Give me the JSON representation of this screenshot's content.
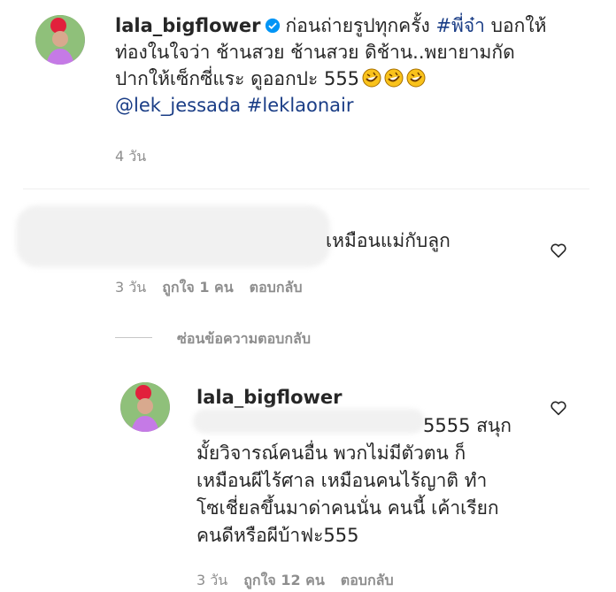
{
  "post": {
    "username": "lala_bigflower",
    "caption_line1": "ก่อนถ่ายรูปทุกครั้ง",
    "hashtag1": "#พี่จ๋า",
    "caption_line1_end": "บอกให้",
    "caption_line2": "ท่องในใจว่า ช้านสวย ช้านสวย ดิช้าน..พยายามกัด",
    "caption_line3": "ปากให้เซ็กซี่แระ ดูออกปะ 555",
    "mention": "@lek_jessada",
    "hashtag2": "#leklaonair",
    "time": "4 วัน"
  },
  "comment1": {
    "text": "เหมือนแม่กับลูก",
    "time": "3 วัน",
    "likes": "ถูกใจ 1 คน",
    "reply": "ตอบกลับ"
  },
  "hide_replies": "ซ่อนข้อความตอบกลับ",
  "reply1": {
    "username": "lala_bigflower",
    "line1_end": "5555 สนุก",
    "line2": "มั้ยวิจารณ์คนอื่น พวกไม่มีตัวตน ก็",
    "line3": "เหมือนผีไร้ศาล เหมือนคนไร้ญาติ ทำ",
    "line4": "โซเชี่ยลขึ้นมาด่าคนนั่น คนนี้ เค้าเรียก",
    "line5": "คนดีหรือผีบ้าฟะ555",
    "time": "3 วัน",
    "likes": "ถูกใจ 12 คน",
    "reply": "ตอบกลับ"
  },
  "icons": {
    "verified": "verified-badge-icon",
    "heart": "heart-outline-icon",
    "emoji": "rofl-emoji-icon"
  },
  "colors": {
    "link": "#1a3d86",
    "verified": "#0095f6",
    "muted": "#8e8e8e"
  }
}
